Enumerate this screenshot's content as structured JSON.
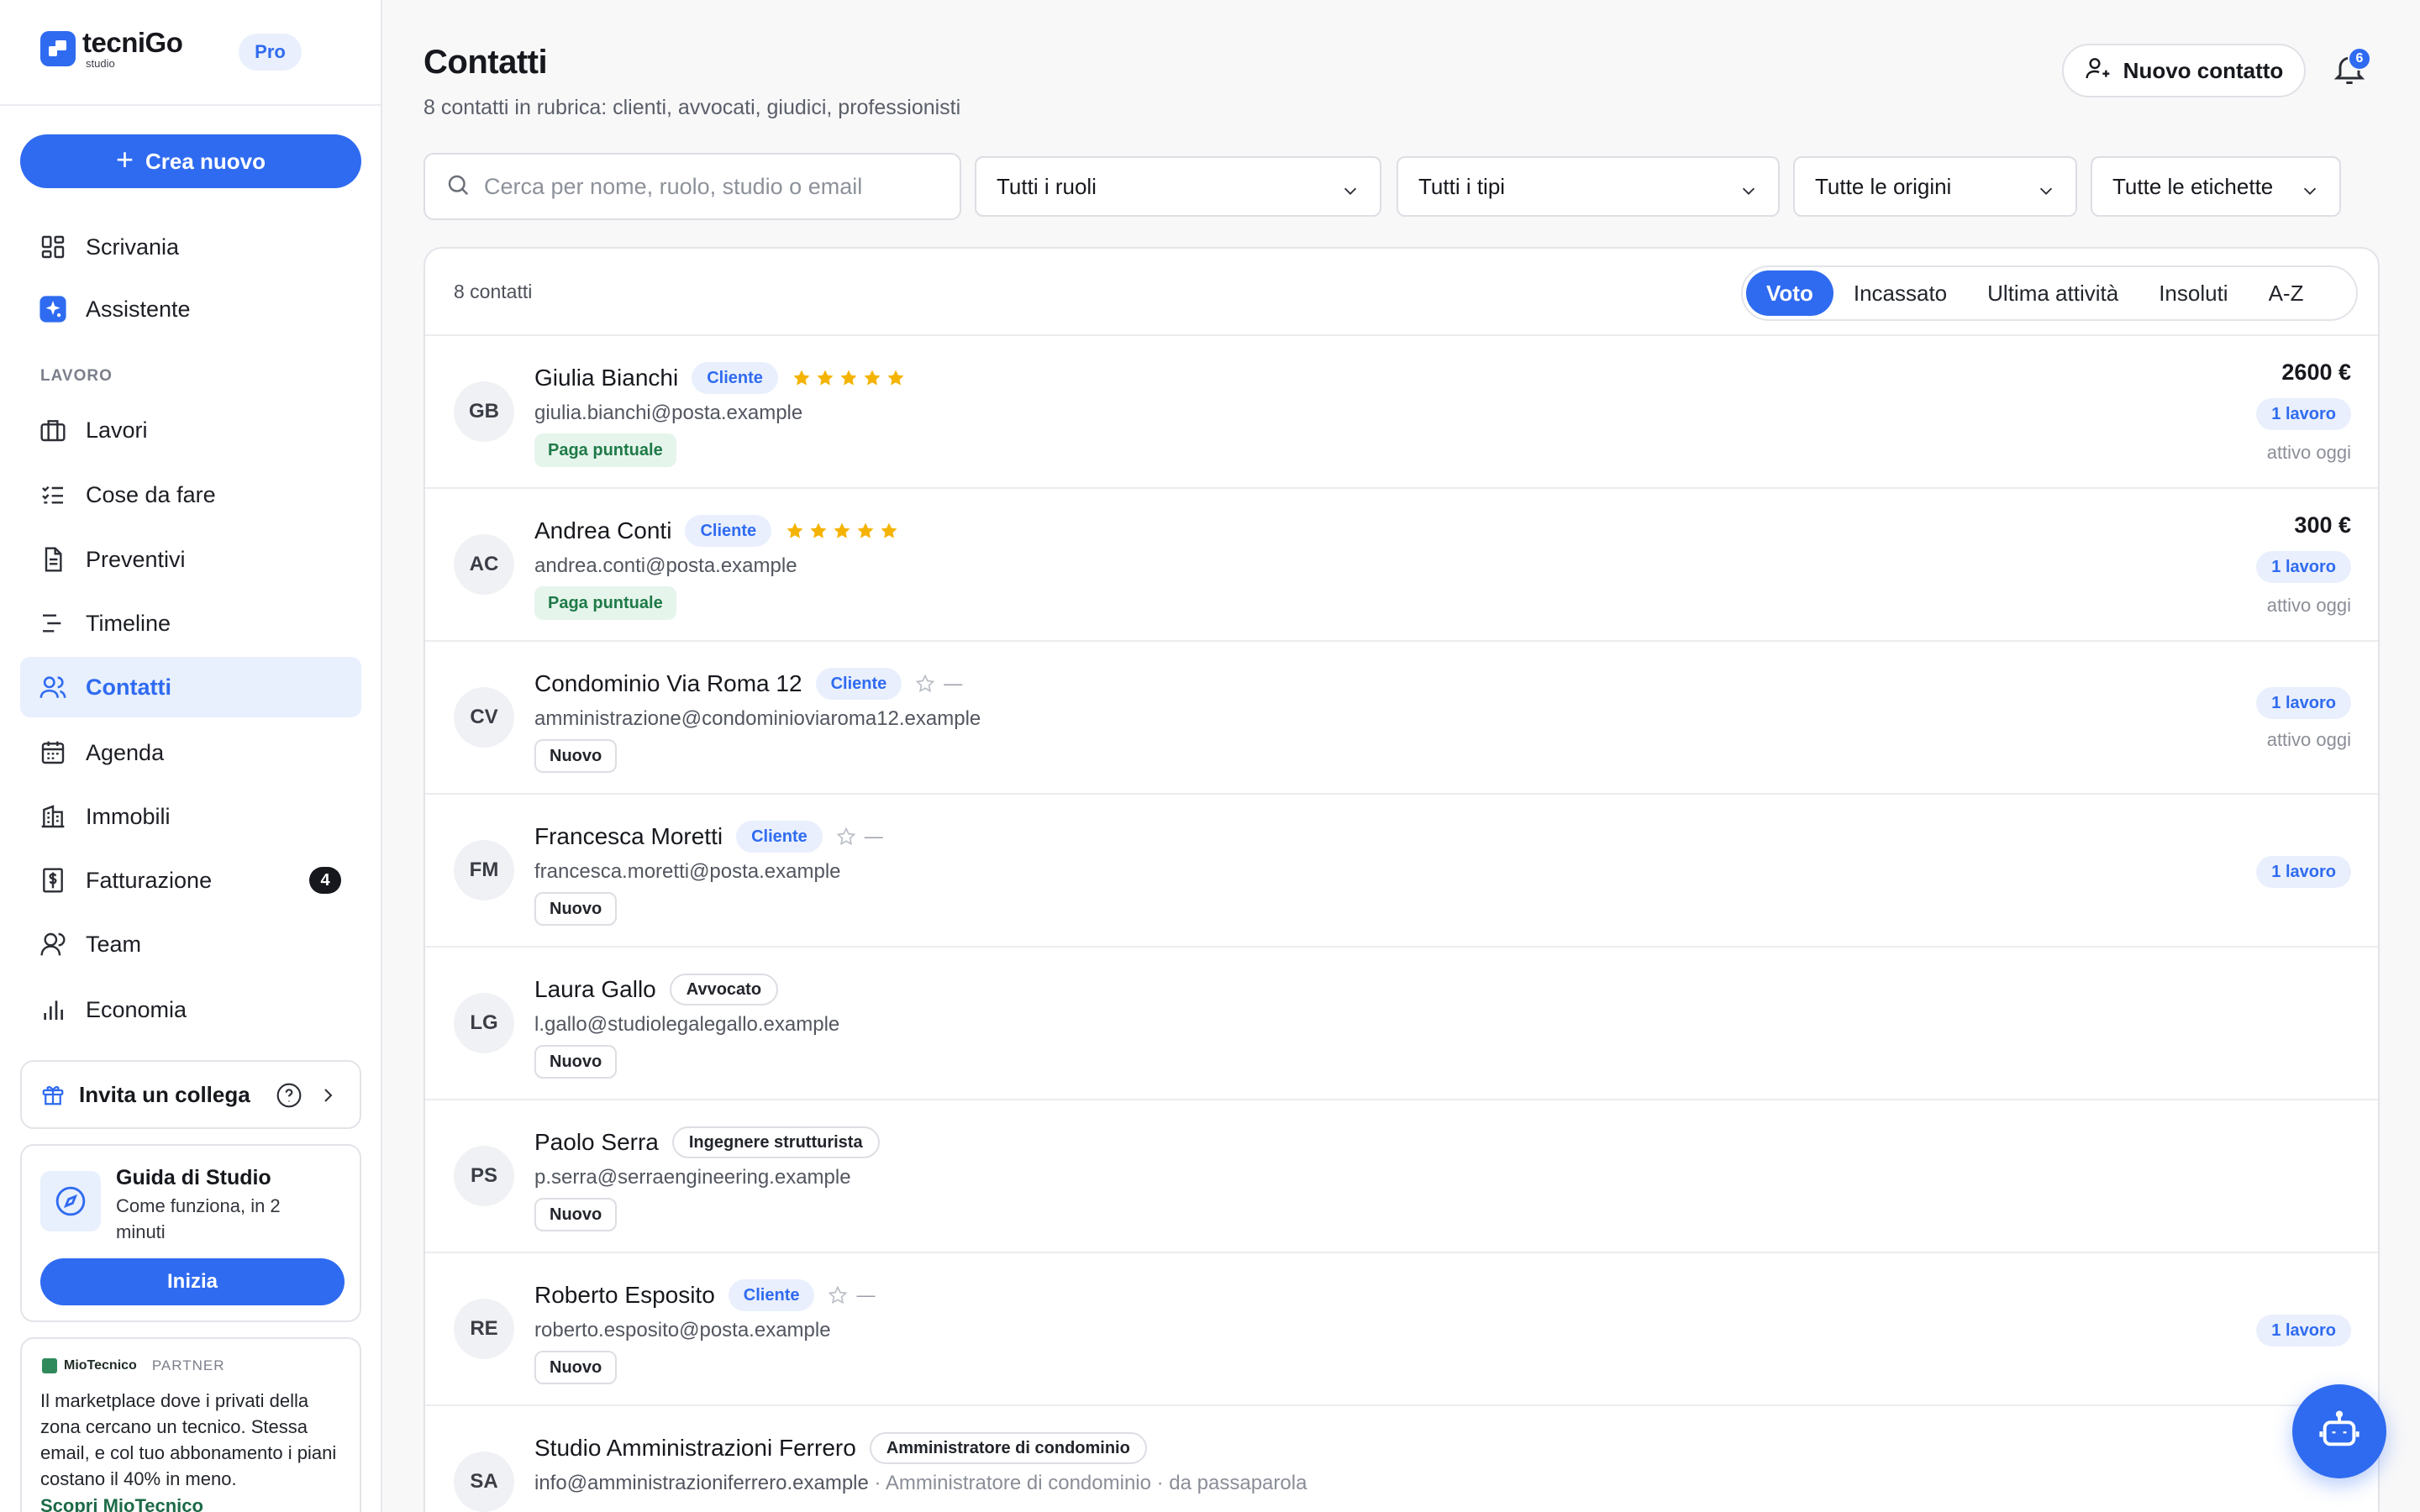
{
  "brand": {
    "name": "tecniGo",
    "sub": "studio",
    "plan": "Pro"
  },
  "sidebar": {
    "create_label": "Crea nuovo",
    "top_items": [
      {
        "label": "Scrivania",
        "icon": "dashboard-icon"
      },
      {
        "label": "Assistente",
        "icon": "sparkle-icon"
      }
    ],
    "section_label": "LAVORO",
    "items": [
      {
        "label": "Lavori",
        "icon": "briefcase-icon"
      },
      {
        "label": "Cose da fare",
        "icon": "checklist-icon"
      },
      {
        "label": "Preventivi",
        "icon": "document-icon"
      },
      {
        "label": "Timeline",
        "icon": "timeline-icon"
      },
      {
        "label": "Contatti",
        "icon": "users-icon",
        "active": true
      },
      {
        "label": "Agenda",
        "icon": "calendar-icon"
      },
      {
        "label": "Immobili",
        "icon": "building-icon"
      },
      {
        "label": "Fatturazione",
        "icon": "invoice-icon",
        "count": "4"
      },
      {
        "label": "Team",
        "icon": "team-icon"
      },
      {
        "label": "Economia",
        "icon": "bar-chart-icon"
      }
    ],
    "invite_label": "Invita un collega",
    "guide": {
      "title": "Guida di Studio",
      "subtitle": "Come funziona, in 2 minuti",
      "button": "Inizia"
    },
    "partner": {
      "name": "MioTecnico",
      "tag": "PARTNER",
      "text": "Il marketplace dove i privati della zona cercano un tecnico. Stessa email, e col tuo abbonamento i piani costano il 40% in meno.",
      "link": "Scopri MioTecnico"
    }
  },
  "header": {
    "title": "Contatti",
    "subtitle": "8 contatti in rubrica: clienti, avvocati, giudici, professionisti",
    "new_contact": "Nuovo contatto",
    "notifications": "6"
  },
  "filters": {
    "search_placeholder": "Cerca per nome, ruolo, studio o email",
    "roles": "Tutti i ruoli",
    "types": "Tutti i tipi",
    "origins": "Tutte le origini",
    "labels": "Tutte le etichette"
  },
  "list": {
    "count": "8 contatti",
    "sort_tabs": [
      "Voto",
      "Incassato",
      "Ultima attività",
      "Insoluti",
      "A-Z"
    ],
    "active_sort": "Voto",
    "contacts": [
      {
        "initials": "GB",
        "name": "Giulia Bianchi",
        "role": "Cliente",
        "role_kind": "client",
        "rating": 5,
        "email": "giulia.bianchi@posta.example",
        "tag": "Paga puntuale",
        "tag_kind": "green",
        "amount": "2600 €",
        "jobs": "1 lavoro",
        "activity": "attivo oggi"
      },
      {
        "initials": "AC",
        "name": "Andrea Conti",
        "role": "Cliente",
        "role_kind": "client",
        "rating": 5,
        "email": "andrea.conti@posta.example",
        "tag": "Paga puntuale",
        "tag_kind": "green",
        "amount": "300 €",
        "jobs": "1 lavoro",
        "activity": "attivo oggi"
      },
      {
        "initials": "CV",
        "name": "Condominio Via Roma 12",
        "role": "Cliente",
        "role_kind": "client",
        "rating": 0,
        "email": "amministrazione@condominioviaroma12.example",
        "tag": "Nuovo",
        "tag_kind": "neutral",
        "amount": "",
        "jobs": "1 lavoro",
        "activity": "attivo oggi"
      },
      {
        "initials": "FM",
        "name": "Francesca Moretti",
        "role": "Cliente",
        "role_kind": "client",
        "rating": 0,
        "email": "francesca.moretti@posta.example",
        "tag": "Nuovo",
        "tag_kind": "neutral",
        "amount": "",
        "jobs": "1 lavoro",
        "activity": ""
      },
      {
        "initials": "LG",
        "name": "Laura Gallo",
        "role": "Avvocato",
        "role_kind": "other",
        "rating": null,
        "email": "l.gallo@studiolegalegallo.example",
        "tag": "Nuovo",
        "tag_kind": "neutral",
        "amount": "",
        "jobs": "",
        "activity": ""
      },
      {
        "initials": "PS",
        "name": "Paolo Serra",
        "role": "Ingegnere strutturista",
        "role_kind": "other",
        "rating": null,
        "email": "p.serra@serraengineering.example",
        "tag": "Nuovo",
        "tag_kind": "neutral",
        "amount": "",
        "jobs": "",
        "activity": ""
      },
      {
        "initials": "RE",
        "name": "Roberto Esposito",
        "role": "Cliente",
        "role_kind": "client",
        "rating": 0,
        "email": "roberto.esposito@posta.example",
        "tag": "Nuovo",
        "tag_kind": "neutral",
        "amount": "",
        "jobs": "1 lavoro",
        "activity": ""
      },
      {
        "initials": "SA",
        "name": "Studio Amministrazioni Ferrero",
        "role": "Amministratore di condominio",
        "role_kind": "other",
        "rating": null,
        "email": "info@amministrazioniferrero.example",
        "email_extra": " · Amministratore di condominio · da passaparola",
        "tag": "",
        "tag_kind": "",
        "amount": "",
        "jobs": "",
        "activity": ""
      }
    ]
  },
  "colors": {
    "accent": "#2f6bf0",
    "star": "#f5b301",
    "green": "#1e7a47"
  }
}
